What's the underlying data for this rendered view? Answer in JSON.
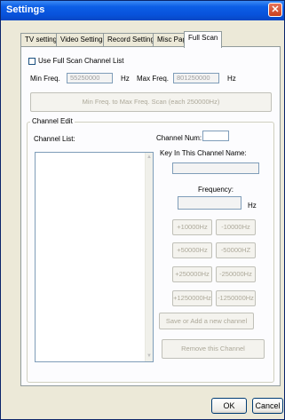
{
  "window": {
    "title": "Settings"
  },
  "tabs": [
    {
      "label": "TV settings",
      "active": false
    },
    {
      "label": "Video Settings",
      "active": false
    },
    {
      "label": "Record Settings",
      "active": false
    },
    {
      "label": "Misc Page",
      "active": false
    },
    {
      "label": "Full Scan",
      "active": true
    }
  ],
  "full_scan": {
    "use_list_label": "Use Full Scan Channel List",
    "use_list_checked": false,
    "min_freq_label": "Min Freq.",
    "min_freq_value": "55250000",
    "hz_label_1": "Hz",
    "max_freq_label": "Max Freq.",
    "max_freq_value": "801250000",
    "hz_label_2": "Hz",
    "scan_button": "Min Freq. to Max Freq. Scan (each 250000Hz)"
  },
  "channel_edit": {
    "group_title": "Channel Edit",
    "channel_list_label": "Channel List:",
    "channel_num_label": "Channel Num:",
    "channel_num_value": "",
    "name_label": "Key In This Channel Name:",
    "name_value": "",
    "frequency_label": "Frequency:",
    "frequency_value": "",
    "hz_label": "Hz",
    "step_buttons": [
      [
        "+10000Hz",
        "-10000Hz"
      ],
      [
        "+50000Hz",
        "-50000HZ"
      ],
      [
        "+250000Hz",
        "-250000Hz"
      ],
      [
        "+1250000Hz",
        "-1250000Hz"
      ]
    ],
    "save_button": "Save or Add a new channel",
    "remove_button": "Remove this Channel"
  },
  "footer": {
    "ok": "OK",
    "cancel": "Cancel"
  },
  "colors": {
    "title_bar": "#0853dc",
    "dialog_bg": "#ece9d8",
    "panel_bg": "#fcfcfe",
    "disabled_text": "#aca899"
  }
}
